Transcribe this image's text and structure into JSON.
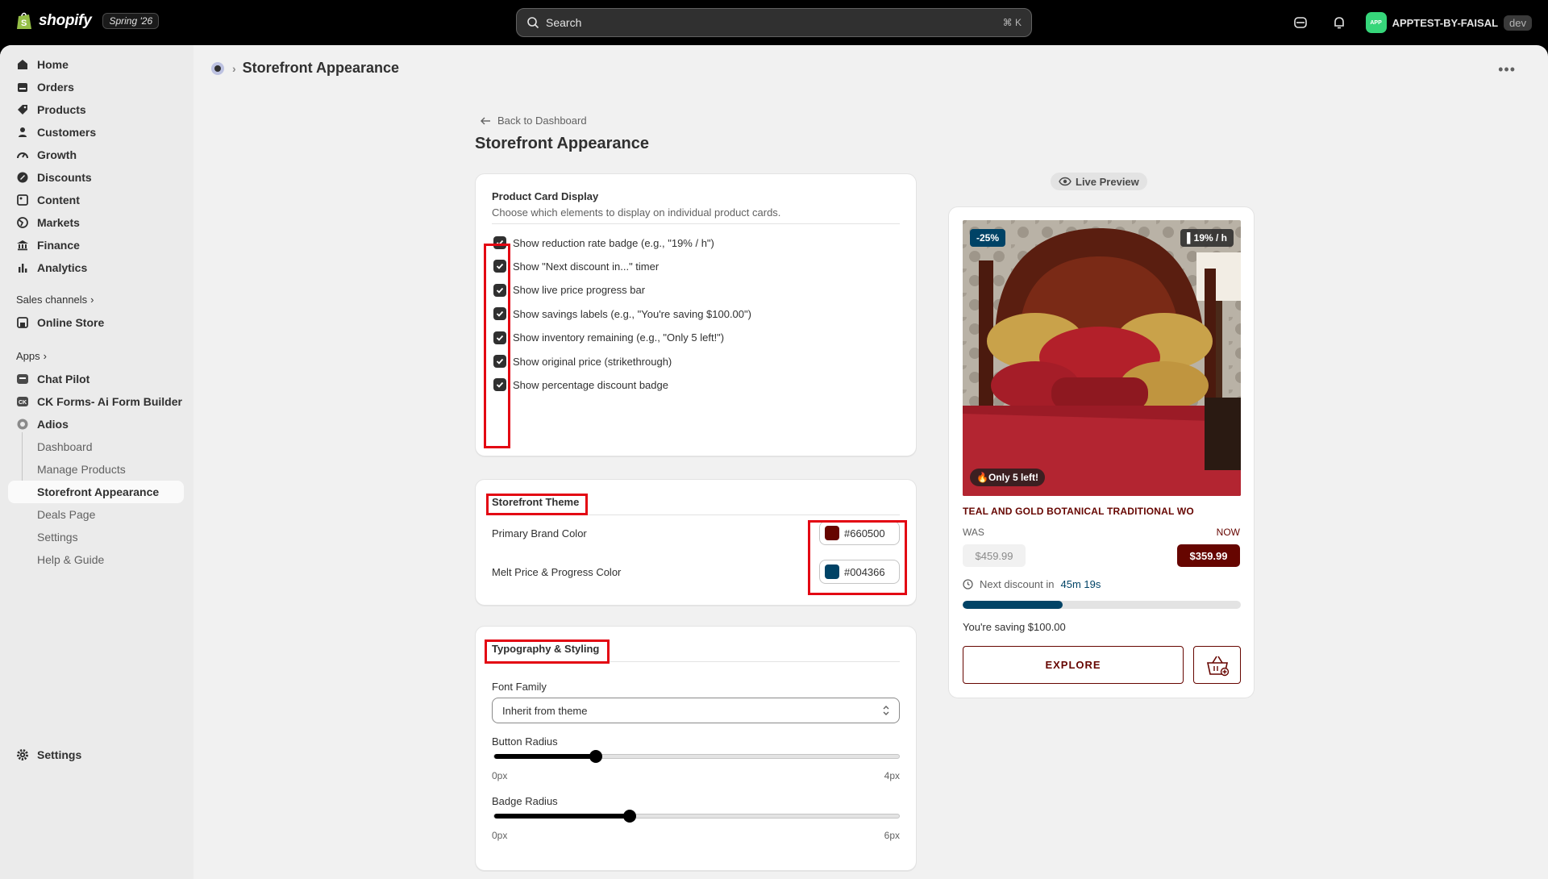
{
  "topbar": {
    "brand": "shopify",
    "release_badge": "Spring '26",
    "search_placeholder": "Search",
    "search_shortcut": "⌘  K",
    "store_avatar": "APP",
    "store_name": "APPTEST-BY-FAISAL",
    "store_env": "dev"
  },
  "sidebar": {
    "items": [
      {
        "label": "Home",
        "icon": "home-icon"
      },
      {
        "label": "Orders",
        "icon": "orders-icon"
      },
      {
        "label": "Products",
        "icon": "tag-icon"
      },
      {
        "label": "Customers",
        "icon": "person-icon"
      },
      {
        "label": "Growth",
        "icon": "gauge-icon"
      },
      {
        "label": "Discounts",
        "icon": "discount-icon"
      },
      {
        "label": "Content",
        "icon": "content-icon"
      },
      {
        "label": "Markets",
        "icon": "globe-icon"
      },
      {
        "label": "Finance",
        "icon": "bank-icon"
      },
      {
        "label": "Analytics",
        "icon": "chart-bar-icon"
      }
    ],
    "sales_channels_label": "Sales channels",
    "online_store": "Online Store",
    "apps_label": "Apps",
    "apps": [
      "Chat Pilot",
      "CK Forms- Ai Form Builder",
      "Adios"
    ],
    "adios_sub": [
      "Dashboard",
      "Manage Products",
      "Storefront Appearance",
      "Deals Page",
      "Settings",
      "Help & Guide"
    ],
    "settings": "Settings"
  },
  "header": {
    "breadcrumb": "Storefront Appearance"
  },
  "page": {
    "back_link": "Back to Dashboard",
    "title": "Storefront Appearance"
  },
  "product_card_display": {
    "title": "Product Card Display",
    "subtitle": "Choose which elements to display on individual product cards.",
    "options": [
      {
        "label": "Show reduction rate badge (e.g., \"19% / h\")",
        "checked": true
      },
      {
        "label": "Show \"Next discount in...\" timer",
        "checked": true
      },
      {
        "label": "Show live price progress bar",
        "checked": true
      },
      {
        "label": "Show savings labels (e.g., \"You're saving $100.00\")",
        "checked": true
      },
      {
        "label": "Show inventory remaining (e.g., \"Only 5 left!\")",
        "checked": true
      },
      {
        "label": "Show original price (strikethrough)",
        "checked": true
      },
      {
        "label": "Show percentage discount badge",
        "checked": true
      }
    ]
  },
  "storefront_theme": {
    "title": "Storefront Theme",
    "primary_label": "Primary Brand Color",
    "primary_value": "#660500",
    "melt_label": "Melt Price & Progress Color",
    "melt_value": "#004366"
  },
  "typography": {
    "title": "Typography & Styling",
    "font_family_label": "Font Family",
    "font_family_value": "Inherit from theme",
    "button_radius_label": "Button Radius",
    "button_radius_value": 1,
    "button_radius_min": "0px",
    "button_radius_max": "4px",
    "badge_radius_label": "Badge Radius",
    "badge_radius_value": 2,
    "badge_radius_min": "0px",
    "badge_radius_max": "6px"
  },
  "preview": {
    "label": "Live Preview",
    "discount_badge": "-25%",
    "rate_badge": "19% / h",
    "stock_badge": "Only 5 left!",
    "product_title": "TEAL AND GOLD BOTANICAL TRADITIONAL WO",
    "was_label": "WAS",
    "now_label": "NOW",
    "was_price": "$459.99",
    "now_price": "$359.99",
    "next_discount_label": "Next discount in",
    "next_discount_time": "45m 19s",
    "progress": 0.36,
    "saving_text": "You're saving $100.00",
    "explore_label": "EXPLORE"
  },
  "colors": {
    "primary": "#660500",
    "melt": "#004366",
    "annotation": "#e30613"
  }
}
